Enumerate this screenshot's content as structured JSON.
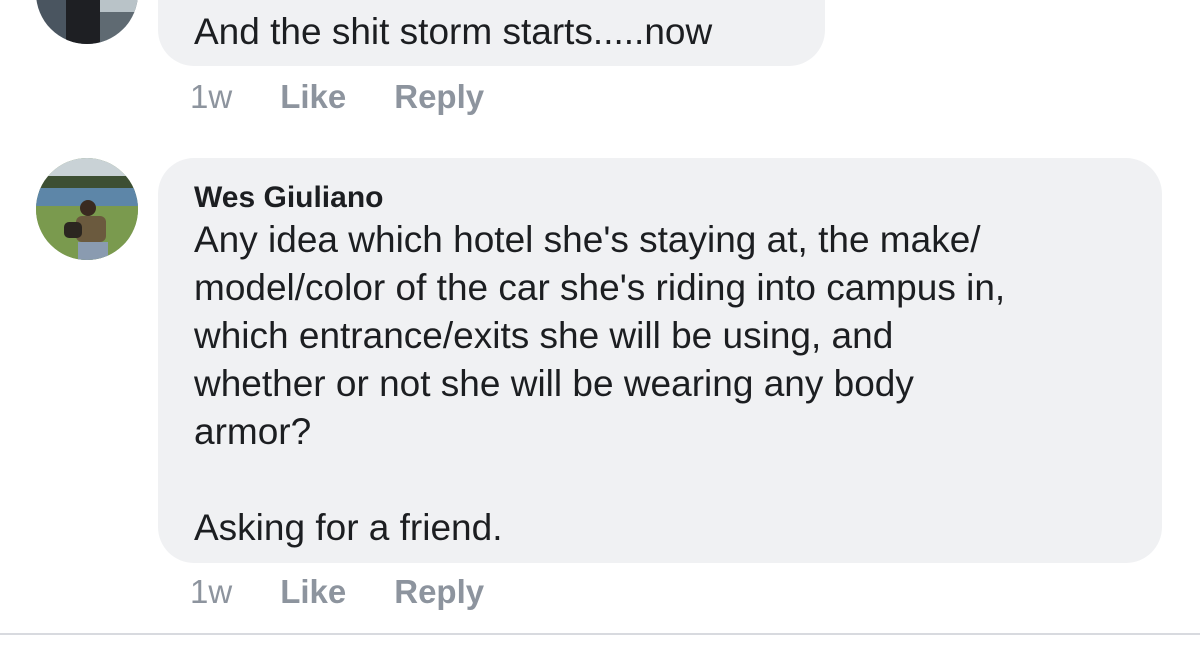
{
  "comments": [
    {
      "avatar_icon": "user-avatar-photo",
      "text": "And the shit storm starts.....now",
      "time": "1w",
      "like_label": "Like",
      "reply_label": "Reply"
    },
    {
      "avatar_icon": "user-avatar-photo",
      "author": "Wes Giuliano",
      "text": "Any idea which hotel she's staying at, the make/\nmodel/color of the car she's riding into campus in,\nwhich entrance/exits she will be using, and\nwhether or not she will be wearing any body\narmor?\n\nAsking for a friend.",
      "time": "1w",
      "like_label": "Like",
      "reply_label": "Reply"
    }
  ],
  "colors": {
    "bubble_bg": "#f0f1f3",
    "text": "#1c1e21",
    "meta": "#8d949e",
    "divider": "#d8dadf"
  }
}
